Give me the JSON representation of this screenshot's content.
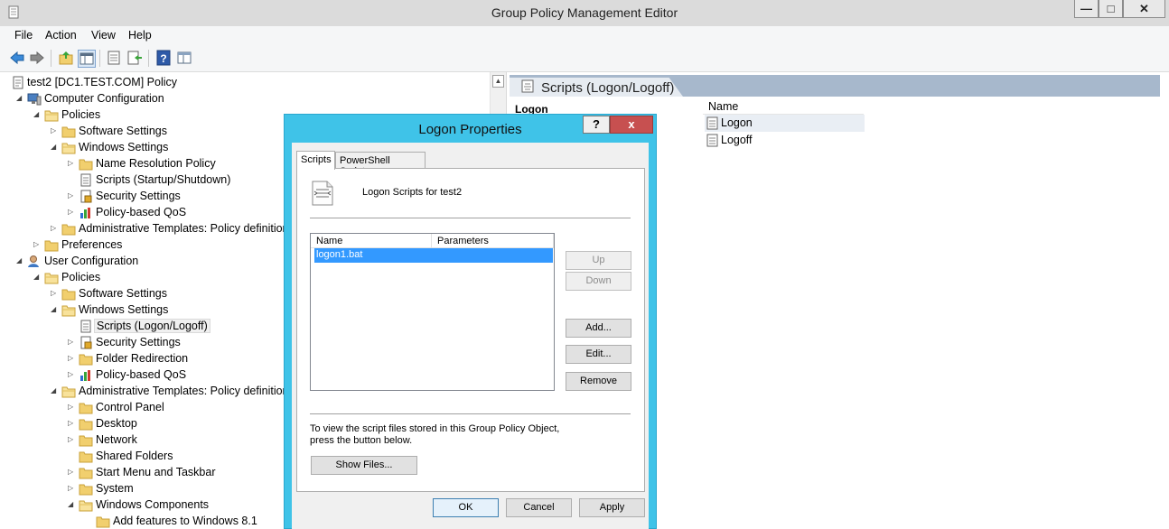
{
  "window": {
    "title": "Group Policy Management Editor",
    "minimize": "—",
    "maximize": "□",
    "close": "✕"
  },
  "menu": [
    "File",
    "Action",
    "View",
    "Help"
  ],
  "toolbar": {
    "icons": [
      "back-icon",
      "forward-icon",
      "up-folder-icon",
      "show-hide-tree-icon",
      "properties-icon",
      "export-list-icon",
      "help-icon",
      "console-view-icon"
    ]
  },
  "tree": [
    {
      "label": "test2 [DC1.TEST.COM] Policy",
      "icon": "policy-document-icon"
    },
    {
      "label": "Computer Configuration",
      "icon": "computer-icon"
    },
    {
      "label": "Policies",
      "icon": "folder-icon"
    },
    {
      "label": "Software Settings",
      "icon": "folder-icon"
    },
    {
      "label": "Windows Settings",
      "icon": "folder-icon"
    },
    {
      "label": "Name Resolution Policy",
      "icon": "folder-icon"
    },
    {
      "label": "Scripts (Startup/Shutdown)",
      "icon": "script-icon"
    },
    {
      "label": "Security Settings",
      "icon": "security-icon"
    },
    {
      "label": "Policy-based QoS",
      "icon": "chart-icon"
    },
    {
      "label": "Administrative Templates: Policy definitions",
      "icon": "folder-icon"
    },
    {
      "label": "Preferences",
      "icon": "folder-icon"
    },
    {
      "label": "User Configuration",
      "icon": "user-icon"
    },
    {
      "label": "Policies",
      "icon": "folder-icon"
    },
    {
      "label": "Software Settings",
      "icon": "folder-icon"
    },
    {
      "label": "Windows Settings",
      "icon": "folder-icon"
    },
    {
      "label": "Scripts (Logon/Logoff)",
      "icon": "script-icon"
    },
    {
      "label": "Security Settings",
      "icon": "security-icon"
    },
    {
      "label": "Folder Redirection",
      "icon": "folder-icon"
    },
    {
      "label": "Policy-based QoS",
      "icon": "chart-icon"
    },
    {
      "label": "Administrative Templates: Policy definitions",
      "icon": "folder-icon"
    },
    {
      "label": "Control Panel",
      "icon": "folder-icon"
    },
    {
      "label": "Desktop",
      "icon": "folder-icon"
    },
    {
      "label": "Network",
      "icon": "folder-icon"
    },
    {
      "label": "Shared Folders",
      "icon": "folder-icon"
    },
    {
      "label": "Start Menu and Taskbar",
      "icon": "folder-icon"
    },
    {
      "label": "System",
      "icon": "folder-icon"
    },
    {
      "label": "Windows Components",
      "icon": "folder-icon"
    },
    {
      "label": "Add features to Windows 8.1",
      "icon": "folder-icon"
    }
  ],
  "right_pane": {
    "title": "Scripts (Logon/Logoff)",
    "subtitle": "Logon",
    "column_name": "Name",
    "items": [
      "Logon",
      "Logoff"
    ]
  },
  "dialog": {
    "title": "Logon Properties",
    "help": "?",
    "close": "x",
    "tabs": [
      "Scripts",
      "PowerShell Scripts"
    ],
    "heading": "Logon Scripts for test2",
    "table_headers": [
      "Name",
      "Parameters"
    ],
    "rows": [
      {
        "name": "logon1.bat",
        "parameters": ""
      }
    ],
    "buttons": {
      "up": "Up",
      "down": "Down",
      "add": "Add...",
      "edit": "Edit...",
      "remove": "Remove",
      "show_files": "Show Files..."
    },
    "info": "To view the script files stored in this Group Policy Object, press the button below.",
    "footer": {
      "ok": "OK",
      "cancel": "Cancel",
      "apply": "Apply"
    }
  }
}
